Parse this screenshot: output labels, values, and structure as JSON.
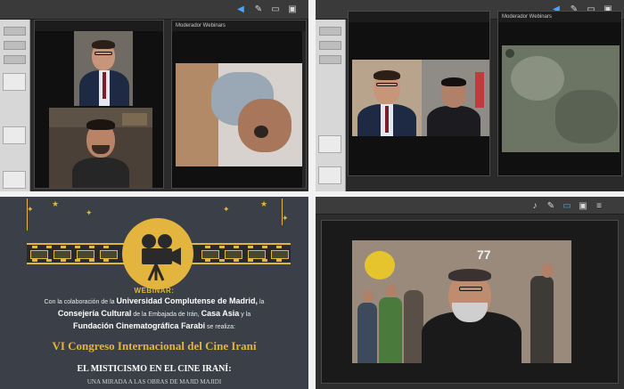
{
  "q1": {
    "pane_right_title": "Moderador Webinars"
  },
  "q2": {
    "pane_right_title": "Moderador Webinars"
  },
  "q3_poster": {
    "heading": "WEBINAR:",
    "line1_pre": "Con la colaboración de la",
    "line1_bold": "Universidad Complutense de Madrid,",
    "line1_post": "la",
    "line2_bold1": "Consejería Cultural",
    "line2_mid": "de la Embajada de Irán,",
    "line2_bold2": "Casa Asia",
    "line2_post": "y la",
    "line3_bold": "Fundación Cinematográfica Farabi",
    "line3_post": "se realiza:",
    "congress_title": "VI Congreso Internacional del Cine Iraní",
    "subtitle": "EL MISTICISMO EN EL CINE IRANÍ:",
    "subtitle2": "UNA MIRADA A LAS OBRAS DE MAJID MAJIDI"
  },
  "q4": {
    "festival_badge": "77"
  },
  "colors": {
    "accent_blue": "#4aa3ff",
    "poster_gold": "#e3b43e",
    "poster_bg": "#3b3f48"
  }
}
